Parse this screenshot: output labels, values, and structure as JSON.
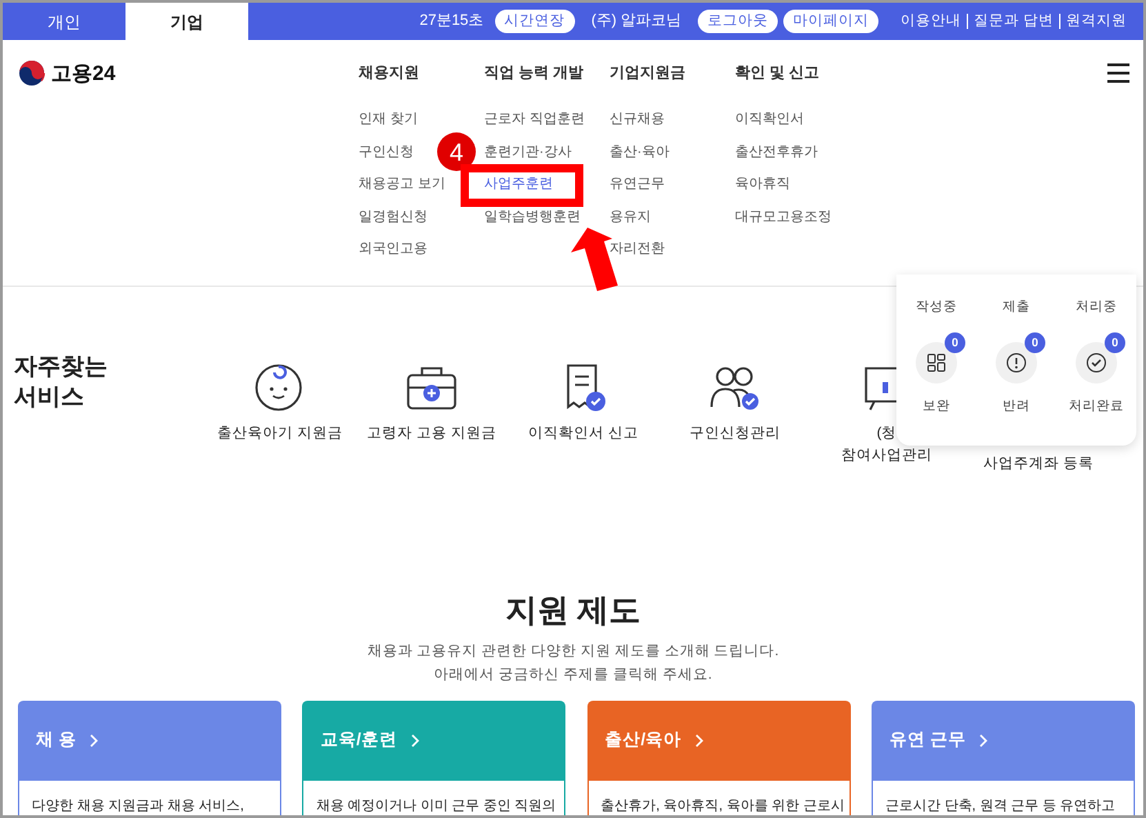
{
  "top_bar": {
    "tabs": [
      {
        "label": "개인",
        "selected": false
      },
      {
        "label": "기업",
        "selected": true
      }
    ],
    "timer": "27분15초",
    "extend_button": "시간연장",
    "user": "(주) 알파코님",
    "buttons": [
      "로그아웃",
      "마이페이지"
    ],
    "links": [
      "이용안내",
      "질문과 답변",
      "원격지원"
    ]
  },
  "header": {
    "logo": "고용24",
    "menu": [
      {
        "heading": "채용지원",
        "items": [
          {
            "label": "인재 찾기",
            "selected": false
          },
          {
            "label": "구인신청",
            "selected": false
          },
          {
            "label": "채용공고 보기",
            "selected": false
          },
          {
            "label": "일경험신청",
            "selected": false
          },
          {
            "label": "외국인고용",
            "selected": false
          }
        ]
      },
      {
        "heading": "직업 능력 개발",
        "items": [
          {
            "label": "근로자 직업훈련",
            "selected": false
          },
          {
            "label": "훈련기관·강사",
            "selected": false
          },
          {
            "label": "사업주훈련",
            "selected": true
          },
          {
            "label": "일학습병행훈련",
            "selected": false
          }
        ]
      },
      {
        "heading": "기업지원금",
        "items": [
          {
            "label": "신규채용",
            "selected": false
          },
          {
            "label": "출산·육아",
            "selected": false
          },
          {
            "label": "유연근무",
            "selected": false
          },
          {
            "label": "용유지",
            "selected": false
          },
          {
            "label": "자리전환",
            "selected": false
          }
        ]
      },
      {
        "heading": "확인 및 신고",
        "items": [
          {
            "label": "이직확인서",
            "selected": false
          },
          {
            "label": "출산전후휴가",
            "selected": false
          },
          {
            "label": "육아휴직",
            "selected": false
          },
          {
            "label": "대규모고용조정",
            "selected": false
          }
        ]
      }
    ]
  },
  "annotation": {
    "step": "4"
  },
  "frequent_services": {
    "title": "자주찾는 서비스",
    "items": [
      {
        "lines": [
          "출산육아기 지원금"
        ],
        "kind": "baby"
      },
      {
        "lines": [
          "고령자 고용 지원금"
        ],
        "kind": "briefcase"
      },
      {
        "lines": [
          "이직확인서 신고"
        ],
        "kind": "document"
      },
      {
        "lines": [
          "구인신청관리"
        ],
        "kind": "people"
      },
      {
        "lines": [
          "(청",
          "참여사업관리"
        ],
        "kind": "board"
      },
      {
        "lines": [
          "사업주계좌 등록"
        ]
      }
    ]
  },
  "status_panel": {
    "top_labels": [
      "작성중",
      "제출",
      "처리중"
    ],
    "items": [
      {
        "label": "보완",
        "count": "0",
        "kind": "grid"
      },
      {
        "label": "반려",
        "count": "0",
        "kind": "alert"
      },
      {
        "label": "처리완료",
        "count": "0",
        "kind": "check"
      }
    ]
  },
  "support": {
    "title": "지원 제도",
    "description": [
      "채용과 고용유지 관련한 다양한 지원 제도를 소개해 드립니다.",
      "아래에서 궁금하신 주제를 클릭해 주세요."
    ],
    "cards": [
      {
        "title": "채 용",
        "color": "#6b87e6",
        "text": "다양한 채용 지원금과 채용 서비스,"
      },
      {
        "title": "교육/훈련",
        "color": "#17aaa4",
        "text": "채용 예정이거나 이미 근무 중인 직원의"
      },
      {
        "title": "출산/육아",
        "color": "#e86424",
        "text": "출산휴가, 육아휴직, 육아를 위한 근로시"
      },
      {
        "title": "유연 근무",
        "color": "#6b87e6",
        "text": "근로시간 단축, 원격 근무 등 유연하고"
      }
    ]
  }
}
